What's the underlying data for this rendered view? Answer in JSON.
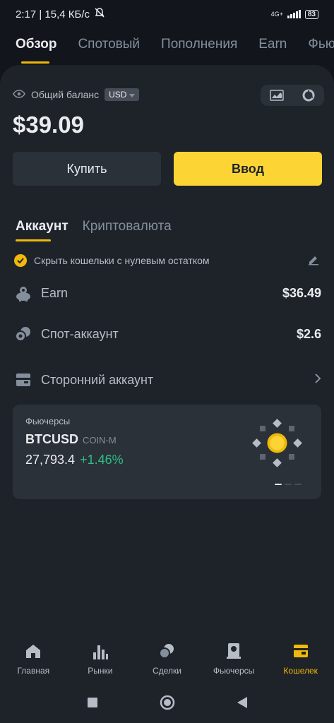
{
  "status_bar": {
    "time_speed": "2:17 | 15,4 КБ/с",
    "network": "4G+",
    "battery": "83"
  },
  "top_tabs": [
    {
      "label": "Обзор",
      "active": true
    },
    {
      "label": "Спотовый"
    },
    {
      "label": "Пополнения"
    },
    {
      "label": "Earn"
    },
    {
      "label": "Фью"
    }
  ],
  "balance": {
    "label": "Общий баланс",
    "currency": "USD",
    "amount": "$39.09"
  },
  "actions": {
    "buy_label": "Купить",
    "deposit_label": "Ввод"
  },
  "sub_tabs": [
    {
      "label": "Аккаунт",
      "active": true
    },
    {
      "label": "Криптовалюта"
    }
  ],
  "hide_zero": {
    "label": "Скрыть кошельки с нулевым остатком"
  },
  "accounts": [
    {
      "label": "Earn",
      "value": "$36.49"
    },
    {
      "label": "Спот-аккаунт",
      "value": "$2.6"
    },
    {
      "label": "Сторонний аккаунт"
    }
  ],
  "futures_card": {
    "title": "Фьючерсы",
    "symbol": "BTCUSD",
    "type": "COIN-M",
    "price": "27,793.4",
    "change": "+1.46%"
  },
  "bottom_nav": [
    {
      "label": "Главная",
      "icon": "home-icon"
    },
    {
      "label": "Рынки",
      "icon": "markets-icon"
    },
    {
      "label": "Сделки",
      "icon": "trades-icon"
    },
    {
      "label": "Фьючерсы",
      "icon": "futures-icon"
    },
    {
      "label": "Кошелек",
      "icon": "wallet-icon",
      "active": true
    }
  ],
  "colors": {
    "accent": "#f0b90b",
    "button_yellow": "#fcd535",
    "positive": "#2ebd85",
    "background": "#12161c",
    "panel": "#1e2329"
  }
}
